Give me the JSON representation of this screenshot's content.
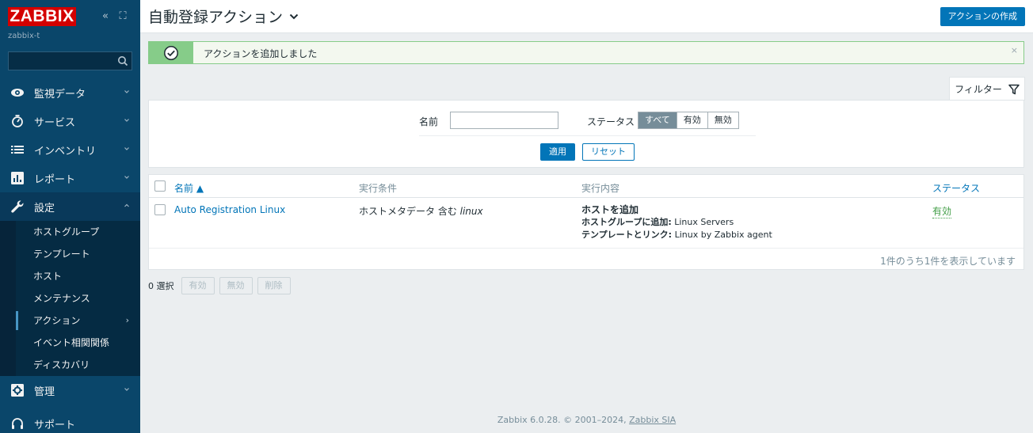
{
  "sidebar": {
    "logo": "ZABBIX",
    "collapse_glyph": "«",
    "kiosk_glyph": "⛶",
    "server_name": "zabbix-t",
    "search_placeholder": "",
    "menu": [
      {
        "label": "監視データ",
        "icon": "eye-icon"
      },
      {
        "label": "サービス",
        "icon": "services-icon"
      },
      {
        "label": "インベントリ",
        "icon": "inventory-list-icon"
      },
      {
        "label": "レポート",
        "icon": "reports-icon"
      },
      {
        "label": "設定",
        "icon": "wrench-icon"
      },
      {
        "label": "管理",
        "icon": "gear-icon"
      },
      {
        "label": "サポート",
        "icon": "support-icon"
      }
    ],
    "submenu": [
      {
        "label": "ホストグループ"
      },
      {
        "label": "テンプレート"
      },
      {
        "label": "ホスト"
      },
      {
        "label": "メンテナンス"
      },
      {
        "label": "アクション",
        "arrow": "›"
      },
      {
        "label": "イベント相関関係"
      },
      {
        "label": "ディスカバリ"
      }
    ]
  },
  "header": {
    "title": "自動登録アクション",
    "create_button": "アクションの作成"
  },
  "message": {
    "text": "アクションを追加しました",
    "close": "×"
  },
  "filter": {
    "tab_label": "フィルター",
    "name_label": "名前",
    "name_value": "",
    "status_label": "ステータス",
    "status_options": [
      "すべて",
      "有効",
      "無効"
    ],
    "status_selected": "すべて",
    "apply_button": "適用",
    "reset_button": "リセット"
  },
  "table": {
    "columns": {
      "name": "名前 ▲",
      "conditions": "実行条件",
      "operations": "実行内容",
      "status": "ステータス"
    },
    "rows": [
      {
        "name": "Auto Registration Linux",
        "condition_prefix": "ホストメタデータ 含む ",
        "condition_value": "linux",
        "op1": "ホストを追加",
        "op2_label": "ホストグループに追加:",
        "op2_value": " Linux Servers",
        "op3_label": "テンプレートとリンク:",
        "op3_value": " Linux by Zabbix agent",
        "status": "有効"
      }
    ],
    "footer_count": "1件のうち1件を表示しています"
  },
  "mass_actions": {
    "selected_count": "0 選択",
    "buttons": [
      "有効",
      "無効",
      "削除"
    ]
  },
  "footer": {
    "text": "Zabbix 6.0.28. © 2001–2024, ",
    "link": "Zabbix SIA"
  },
  "colors": {
    "sidebar_bg": "#0a466a",
    "logo_red": "#d40000",
    "primary_blue": "#0275b8",
    "success_green": "#86cc89",
    "status_green": "#429e47"
  }
}
